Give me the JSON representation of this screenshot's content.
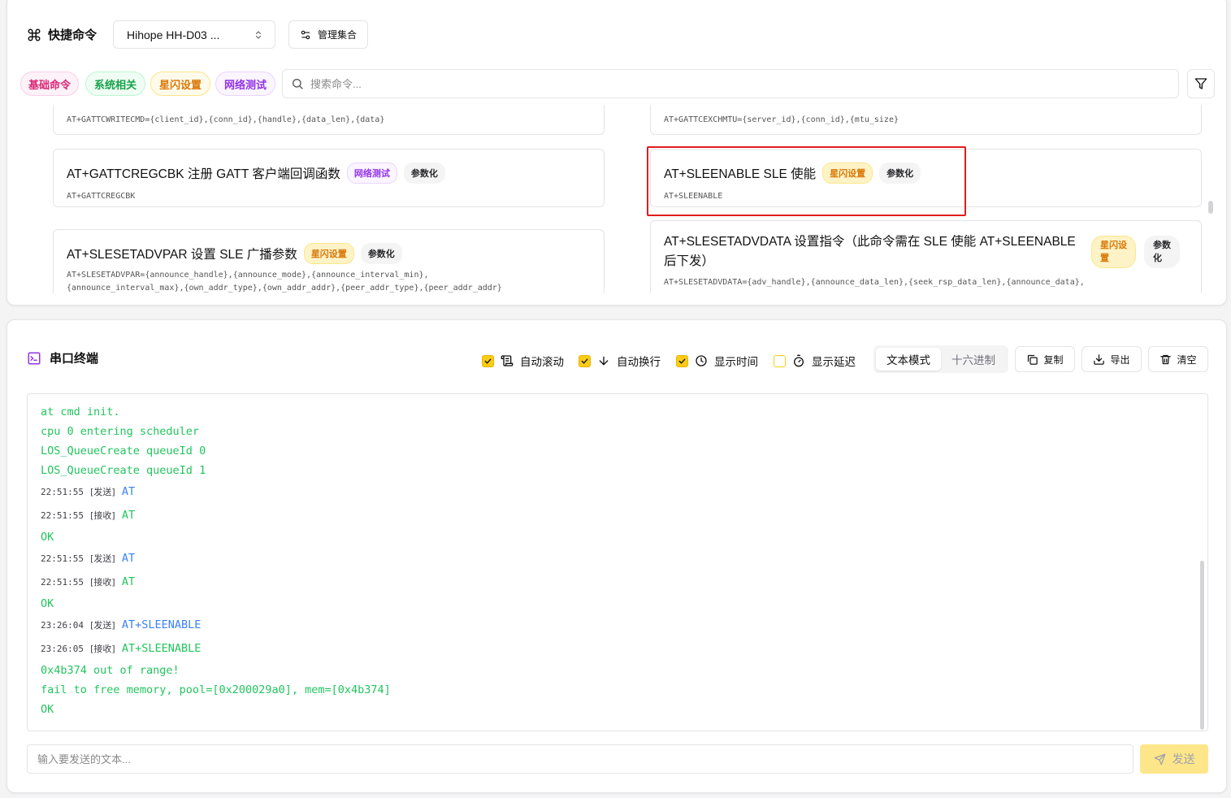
{
  "quick_commands": {
    "title": "快捷命令",
    "device_select": "Hihope HH-D03 ...",
    "manage_label": "管理集合",
    "tags": [
      "基础命令",
      "系统相关",
      "星闪设置",
      "网络测试"
    ],
    "search_placeholder": "搜索命令...",
    "cards": [
      {
        "title": "",
        "command": "AT+GATTCWRITECMD={client_id},{conn_id},{handle},{data_len},{data}"
      },
      {
        "title": "",
        "command": "AT+GATTCEXCHMTU={server_id},{conn_id},{mtu_size}"
      },
      {
        "title": "AT+GATTCREGCBK 注册 GATT 客户端回调函数",
        "badges": [
          "网络测试",
          "参数化"
        ],
        "command": "AT+GATTCREGCBK"
      },
      {
        "title": "AT+SLEENABLE SLE 使能",
        "badges": [
          "星闪设置",
          "参数化"
        ],
        "command": "AT+SLEENABLE"
      },
      {
        "title": "AT+SLESETADVPAR 设置 SLE 广播参数",
        "badges": [
          "星闪设置",
          "参数化"
        ],
        "command": "AT+SLESETADVPAR={announce_handle},{announce_mode},{announce_interval_min},",
        "command2": "{announce_interval_max},{own_addr_type},{own_addr_addr},{peer_addr_type},{peer_addr_addr}"
      },
      {
        "title": "AT+SLESETADVDATA 设置指令（此命令需在 SLE 使能 AT+SLEENABLE",
        "title2": "后下发）",
        "badges": [
          "星闪设\n置",
          "参数\n化"
        ],
        "command": "AT+SLESETADVDATA={adv_handle},{announce_data_len},{seek_rsp_data_len},{announce_data},"
      }
    ]
  },
  "terminal": {
    "title": "串口终端",
    "options": [
      {
        "label": "自动滚动",
        "checked": true
      },
      {
        "label": "自动换行",
        "checked": true
      },
      {
        "label": "显示时间",
        "checked": true
      },
      {
        "label": "显示延迟",
        "checked": false
      }
    ],
    "modes": [
      "文本模式",
      "十六进制"
    ],
    "copy_label": "复制",
    "export_label": "导出",
    "clear_label": "清空",
    "lines": [
      {
        "text": "at cmd init."
      },
      {
        "text": "cpu 0 entering scheduler"
      },
      {
        "text": "LOS_QueueCreate queueId 0"
      },
      {
        "text": "LOS_QueueCreate queueId 1"
      },
      {
        "time": "22:51:55",
        "dir": "[发送]",
        "text": "AT",
        "kind": "sent"
      },
      {
        "time": "22:51:55",
        "dir": "[接收]",
        "text": "AT",
        "kind": "recv"
      },
      {
        "text": "OK"
      },
      {
        "time": "22:51:55",
        "dir": "[发送]",
        "text": "AT",
        "kind": "sent"
      },
      {
        "time": "22:51:55",
        "dir": "[接收]",
        "text": "AT",
        "kind": "recv"
      },
      {
        "text": "OK"
      },
      {
        "time": "23:26:04",
        "dir": "[发送]",
        "text": "AT+SLEENABLE",
        "kind": "sent"
      },
      {
        "time": "23:26:05",
        "dir": "[接收]",
        "text": "AT+SLEENABLE",
        "kind": "recv"
      },
      {
        "text": "0x4b374 out of range!"
      },
      {
        "text": "fail to free memory, pool=[0x200029a0], mem=[0x4b374]"
      },
      {
        "text": "OK"
      }
    ],
    "input_placeholder": "输入要发送的文本...",
    "send_label": "发送"
  }
}
